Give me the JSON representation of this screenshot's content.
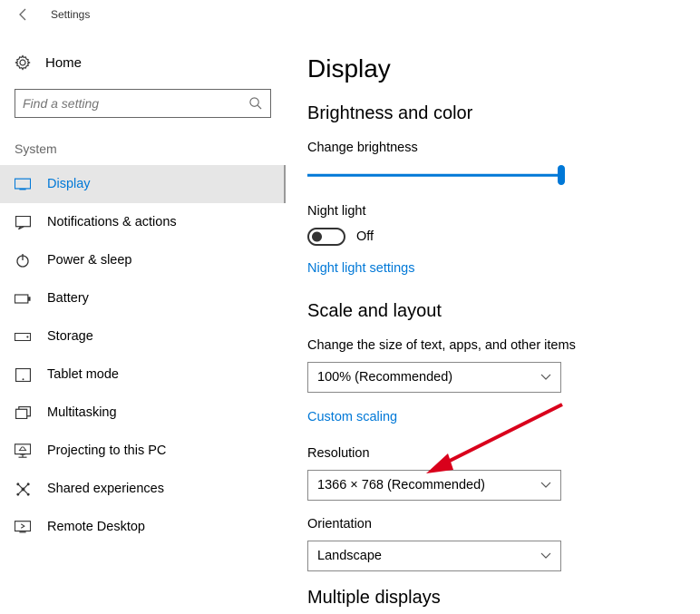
{
  "window": {
    "title": "Settings"
  },
  "home": {
    "label": "Home"
  },
  "search": {
    "placeholder": "Find a setting"
  },
  "section": {
    "label": "System"
  },
  "nav": {
    "items": [
      {
        "label": "Display"
      },
      {
        "label": "Notifications & actions"
      },
      {
        "label": "Power & sleep"
      },
      {
        "label": "Battery"
      },
      {
        "label": "Storage"
      },
      {
        "label": "Tablet mode"
      },
      {
        "label": "Multitasking"
      },
      {
        "label": "Projecting to this PC"
      },
      {
        "label": "Shared experiences"
      },
      {
        "label": "Remote Desktop"
      }
    ]
  },
  "page": {
    "title": "Display",
    "brightness": {
      "section_title": "Brightness and color",
      "slider_label": "Change brightness",
      "slider_value": 100,
      "night_light_label": "Night light",
      "night_light_state": "Off",
      "night_light_settings_link": "Night light settings"
    },
    "scale": {
      "section_title": "Scale and layout",
      "text_size_label": "Change the size of text, apps, and other items",
      "text_size_value": "100% (Recommended)",
      "custom_scaling_link": "Custom scaling",
      "resolution_label": "Resolution",
      "resolution_value": "1366 × 768 (Recommended)",
      "orientation_label": "Orientation",
      "orientation_value": "Landscape"
    },
    "multiple_displays": {
      "section_title": "Multiple displays"
    }
  },
  "colors": {
    "accent": "#0078d7",
    "arrow": "#d9001b"
  }
}
